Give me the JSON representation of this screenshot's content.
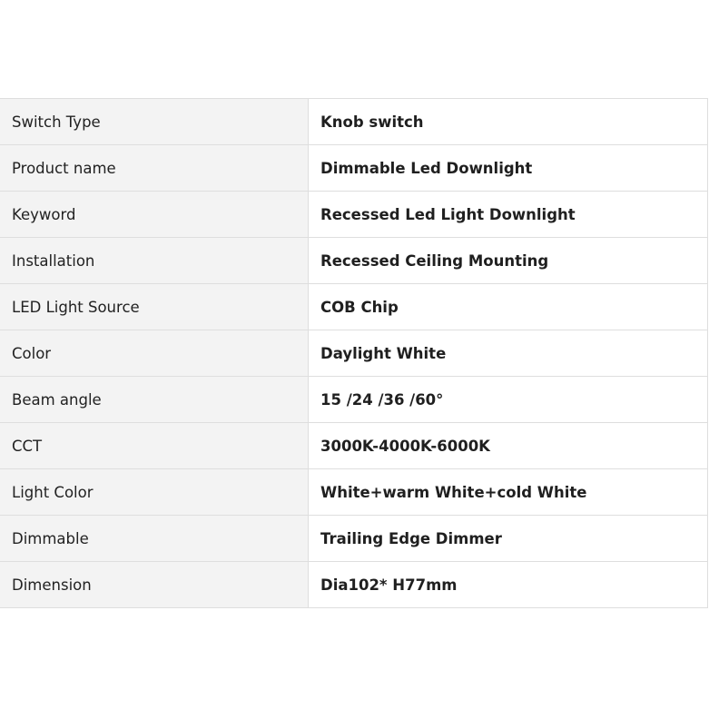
{
  "specs": {
    "rows": [
      {
        "label": "Switch Type",
        "value": "Knob switch"
      },
      {
        "label": "Product name",
        "value": "Dimmable Led Downlight"
      },
      {
        "label": "Keyword",
        "value": "Recessed Led Light Downlight"
      },
      {
        "label": "Installation",
        "value": "Recessed Ceiling Mounting"
      },
      {
        "label": "LED Light Source",
        "value": "COB Chip"
      },
      {
        "label": "Color",
        "value": "Daylight White"
      },
      {
        "label": "Beam angle",
        "value": "15 /24 /36 /60°"
      },
      {
        "label": "CCT",
        "value": "3000K-4000K-6000K"
      },
      {
        "label": "Light Color",
        "value": "White+warm White+cold White"
      },
      {
        "label": "Dimmable",
        "value": "Trailing Edge Dimmer"
      },
      {
        "label": "Dimension",
        "value": "Dia102* H77mm"
      }
    ]
  }
}
